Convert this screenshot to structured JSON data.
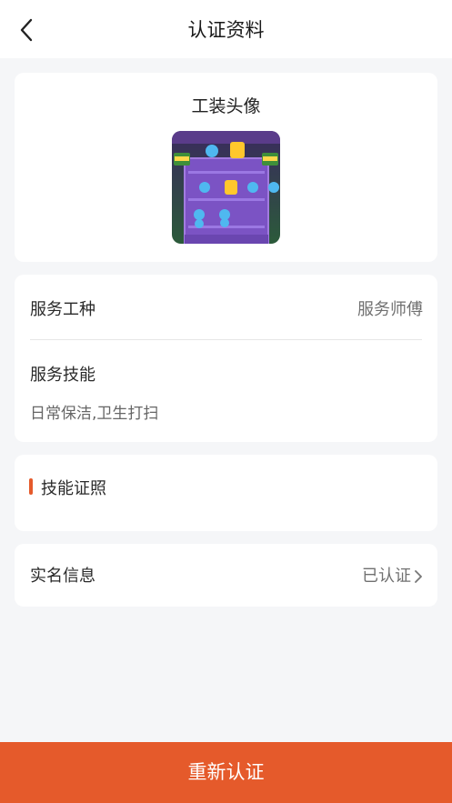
{
  "header": {
    "title": "认证资料"
  },
  "avatar_section": {
    "title": "工装头像"
  },
  "service": {
    "type_label": "服务工种",
    "type_value": "服务师傅",
    "skills_label": "服务技能",
    "skills_value": "日常保洁,卫生打扫"
  },
  "license": {
    "title": "技能证照"
  },
  "realname": {
    "label": "实名信息",
    "status": "已认证"
  },
  "footer": {
    "button_label": "重新认证"
  },
  "colors": {
    "accent": "#e55a2b",
    "background": "#f5f6f8",
    "card": "#ffffff"
  }
}
